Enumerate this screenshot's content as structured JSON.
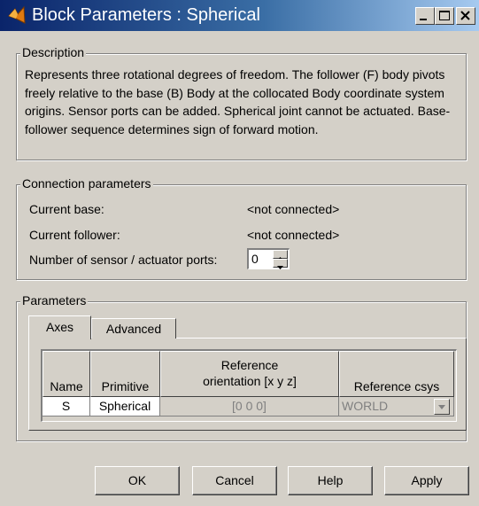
{
  "window": {
    "title": "Block Parameters : Spherical",
    "title_icon": "simulink-block-icon",
    "controls": [
      "minimize-icon",
      "maximize-icon",
      "close-icon"
    ]
  },
  "description": {
    "group_label": "Description",
    "text": "Represents three rotational degrees of freedom. The follower (F) body pivots freely relative to the base (B) Body at the collocated Body coordinate system origins. Sensor ports can be added. Spherical joint cannot be actuated. Base-follower sequence determines sign of forward motion."
  },
  "connection": {
    "group_label": "Connection parameters",
    "current_base_label": "Current base:",
    "current_base_value": "<not connected>",
    "current_follower_label": "Current follower:",
    "current_follower_value": "<not connected>",
    "ports_label": "Number of sensor / actuator ports:",
    "ports_value": "0"
  },
  "parameters": {
    "group_label": "Parameters",
    "tabs": [
      {
        "label": "Axes",
        "active": true
      },
      {
        "label": "Advanced",
        "active": false
      }
    ],
    "table": {
      "headers": [
        "Name",
        "Primitive",
        "Reference orientation [x y z]",
        "Reference csys"
      ],
      "header_lines": {
        "orientation_line1": "Reference",
        "orientation_line2": "orientation [x y z]"
      },
      "rows": [
        {
          "name": "S",
          "primitive": "Spherical",
          "orientation": "[0 0 0]",
          "csys": "WORLD"
        }
      ]
    }
  },
  "buttons": {
    "ok": "OK",
    "cancel": "Cancel",
    "help": "Help",
    "apply": "Apply"
  },
  "colors": {
    "dialog_bg": "#d4d0c8",
    "title_start": "#0a246a",
    "title_end": "#a6caf0",
    "disabled_text": "#808080"
  }
}
